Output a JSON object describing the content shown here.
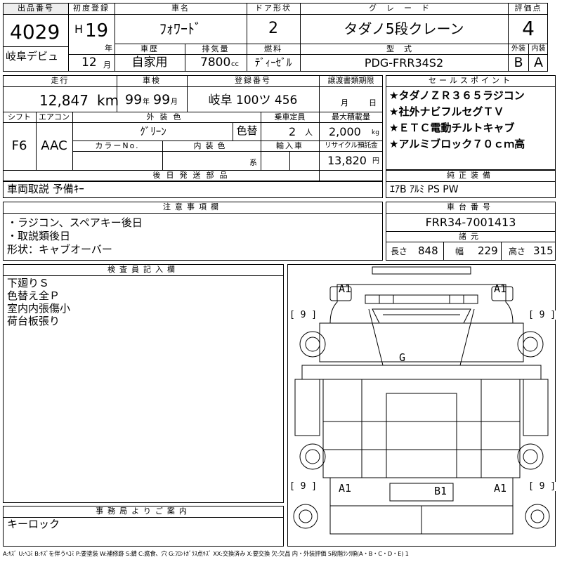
{
  "header": {
    "lot_label": "出品番号",
    "lot_number": "4029",
    "first_reg_label": "初度登録",
    "first_reg_era": "H",
    "first_reg_year": "19",
    "first_reg_year_unit": "年",
    "first_reg_month": "12",
    "first_reg_month_unit": "月",
    "venue": "岐阜デビュ",
    "car_name_label": "車名",
    "car_name": "ﾌｫﾜｰﾄﾞ",
    "doors_label": "ドア形状",
    "doors": "2",
    "grade_label": "グレード",
    "grade": "タダノ5段クレーン",
    "score_label": "評価点",
    "score": "4",
    "history_label": "車歴",
    "history": "自家用",
    "displacement_label": "排気量",
    "displacement": "7800",
    "displacement_unit": "cc",
    "fuel_label": "燃料",
    "fuel": "ﾃﾞｨｰｾﾞﾙ",
    "model_label": "型式",
    "model": "PDG-FRR34S2",
    "exterior_label": "外装",
    "exterior": "B",
    "interior_label": "内装",
    "interior": "A"
  },
  "row2": {
    "mileage_label": "走行",
    "mileage": "12,847",
    "mileage_unit": "km",
    "inspection_label": "車検",
    "inspection_year": "99",
    "inspection_year_unit": "年",
    "inspection_month": "99",
    "inspection_month_unit": "月",
    "plate_label": "登録番号",
    "plate": "岐阜 100ツ 456",
    "transfer_label": "譲渡書類期限",
    "transfer_month_unit": "月",
    "transfer_day_unit": "日",
    "shift_label": "シフト",
    "shift": "F6",
    "ac_label": "エアコン",
    "ac": "AAC",
    "ext_color_label": "外装色",
    "ext_color": "ｸﾞﾘｰﾝ",
    "color_change": "色替",
    "capacity_label": "乗車定員",
    "capacity": "2",
    "capacity_unit": "人",
    "max_load_label": "最大積載量",
    "max_load": "2,000",
    "max_load_unit": "kg",
    "color_no_label": "カラーNo.",
    "int_color_label": "内装色",
    "int_color_suffix": "系",
    "import_label": "輸入車",
    "recycle_label": "リサイクル預託金",
    "recycle": "13,820",
    "recycle_unit": "円",
    "later_label": "後日発送部品",
    "later": "車両取説 予備ｷｰ"
  },
  "sales_points": {
    "label": "セールスポイント",
    "items": [
      "★タダノＺＲ３６５ラジコン",
      "★社外ナビフルセグＴＶ",
      "★ＥＴＣ電動チルトキャブ",
      "★アルミブロック７０ｃｍ高"
    ]
  },
  "equipment": {
    "label": "純正装備",
    "value": "ｴｱB ｱﾙﾐ PS PW"
  },
  "notes": {
    "label": "注意事項欄",
    "items": [
      "・ラジコン、スペアキー後日",
      "・取説類後日",
      "形状：キャブオーバー"
    ]
  },
  "chassis": {
    "label": "車台番号",
    "value": "FRR34-7001413"
  },
  "dims": {
    "label": "諸元",
    "length_label": "長さ",
    "length": "848",
    "width_label": "幅",
    "width": "229",
    "height_label": "高さ",
    "height": "315"
  },
  "inspector": {
    "label": "検査員記入欄",
    "items": [
      "下廻りＳ",
      "色替え全Ｐ",
      "室内内張傷小",
      "荷台板張り"
    ]
  },
  "office": {
    "label": "事務局よりご案内",
    "value": "キーロック"
  },
  "diagram": {
    "marks": {
      "a1_tl": "A1",
      "a1_tr": "A1",
      "g": "G",
      "b1": "B1",
      "a1_bl": "A1",
      "a1_br": "A1"
    },
    "bracket_9": "[ 9 ]"
  },
  "legend": "A:ｷｽﾞ U:ﾍｺﾐ B:ｷｽﾞを伴うﾍｺﾐ P:要塗装 W:補修跡 S:錆 C:腐食、穴 G:ﾌﾛﾝﾄｶﾞﾗｽ点ｷｽﾞ XX:交換済み X:要交換 欠:欠品 内・外装評価 5段階ﾗﾝｸ順(A・B・C・D・E) 1"
}
